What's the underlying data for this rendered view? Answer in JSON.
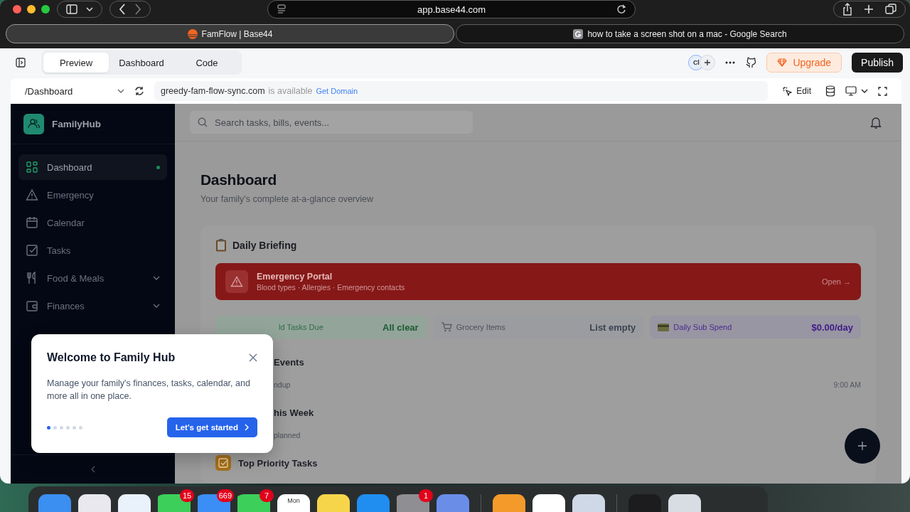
{
  "browser": {
    "url": "app.base44.com",
    "tabs": [
      {
        "title": "FamFlow | Base44",
        "kind": "site",
        "selected": true
      },
      {
        "title": "how to take a screen shot on a mac - Google Search",
        "kind": "google",
        "selected": false
      }
    ]
  },
  "builder": {
    "view_tabs": [
      {
        "label": "Preview",
        "selected": true
      },
      {
        "label": "Dashboard",
        "selected": false
      },
      {
        "label": "Code",
        "selected": false
      }
    ],
    "avatar": "Cl",
    "upgrade": "Upgrade",
    "publish": "Publish"
  },
  "preview_bar": {
    "route": "/Dashboard",
    "domain": "greedy-fam-flow-sync.com",
    "availability": "is available",
    "domain_action": "Get Domain",
    "edit": "Edit"
  },
  "app": {
    "brand": "FamilyHub",
    "nav": [
      {
        "label": "Dashboard",
        "selected": true,
        "expandable": false
      },
      {
        "label": "Emergency",
        "selected": false,
        "expandable": false
      },
      {
        "label": "Calendar",
        "selected": false,
        "expandable": false
      },
      {
        "label": "Tasks",
        "selected": false,
        "expandable": false
      },
      {
        "label": "Food & Meals",
        "selected": false,
        "expandable": true
      },
      {
        "label": "Finances",
        "selected": false,
        "expandable": true
      }
    ],
    "search": {
      "placeholder": "Search tasks, bills, events..."
    },
    "title": "Dashboard",
    "subtitle": "Your family's complete at-a-glance overview",
    "briefing": {
      "title": "Daily Briefing",
      "emergency": {
        "title": "Emergency Portal",
        "subtitle": "Blood types · Allergies · Emergency contacts",
        "action": "Open →"
      },
      "stats": [
        {
          "label": "ld Tasks Due",
          "value": "All clear",
          "kind": "green"
        },
        {
          "label": "Grocery Items",
          "value": "List empty",
          "kind": "gray"
        },
        {
          "label": "Daily Sub Spend",
          "value": "$0.00/day",
          "kind": "purple"
        }
      ],
      "sections": [
        {
          "title": "Events",
          "items": [
            {
              "text": "ndup",
              "time": "9:00 AM"
            }
          ]
        },
        {
          "title": "his Week",
          "items": [
            {
              "text": "planned"
            }
          ]
        }
      ],
      "priority": "Top Priority Tasks"
    }
  },
  "popup": {
    "title": "Welcome to Family Hub",
    "body": "Manage your family's finances, tasks, calendar, and more all in one place.",
    "steps": [
      {
        "selected": true
      },
      {
        "selected": false
      },
      {
        "selected": false
      },
      {
        "selected": false
      },
      {
        "selected": false
      },
      {
        "selected": false
      }
    ],
    "button": "Let's get started"
  },
  "dock": [
    {
      "kind": "finder"
    },
    {
      "kind": "launchpad"
    },
    {
      "kind": "safari"
    },
    {
      "kind": "messages",
      "badge": "15"
    },
    {
      "kind": "mail",
      "badge": "669"
    },
    {
      "kind": "facetime",
      "badge": "7"
    },
    {
      "kind": "calendar",
      "label": "Mon"
    },
    {
      "kind": "notes"
    },
    {
      "kind": "appstore"
    },
    {
      "kind": "settings",
      "badge": "1"
    },
    {
      "kind": "utility"
    },
    {
      "kind": "books"
    },
    {
      "kind": "chrome"
    },
    {
      "kind": "camera"
    },
    {
      "kind": "screenshot"
    },
    {
      "kind": "trash"
    }
  ]
}
